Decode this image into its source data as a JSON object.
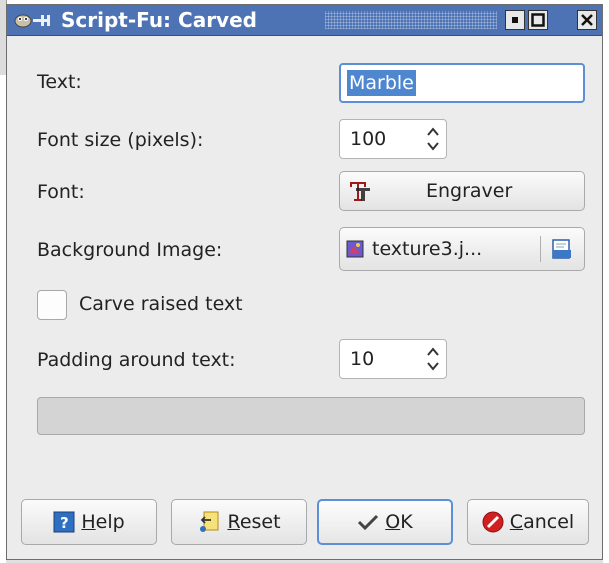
{
  "window": {
    "title": "Script-Fu: Carved"
  },
  "form": {
    "text_label": "Text:",
    "text_value": "Marble",
    "font_size_label": "Font size (pixels):",
    "font_size_value": "100",
    "font_label": "Font:",
    "font_value": "Engraver",
    "background_label": "Background Image:",
    "background_value": "texture3.j...",
    "carve_label": "Carve raised text",
    "carve_checked": false,
    "padding_label": "Padding around text:",
    "padding_value": "10"
  },
  "buttons": {
    "help_underlined": "H",
    "help_rest": "elp",
    "reset_underlined": "R",
    "reset_rest": "eset",
    "ok_underlined": "O",
    "ok_rest": "K",
    "cancel_underlined": "C",
    "cancel_rest": "ancel"
  },
  "colors": {
    "titlebar": "#4e73b5",
    "accent_focus": "#5b8fd8",
    "selection": "#4e86d0",
    "dialog_bg": "#ececec"
  }
}
